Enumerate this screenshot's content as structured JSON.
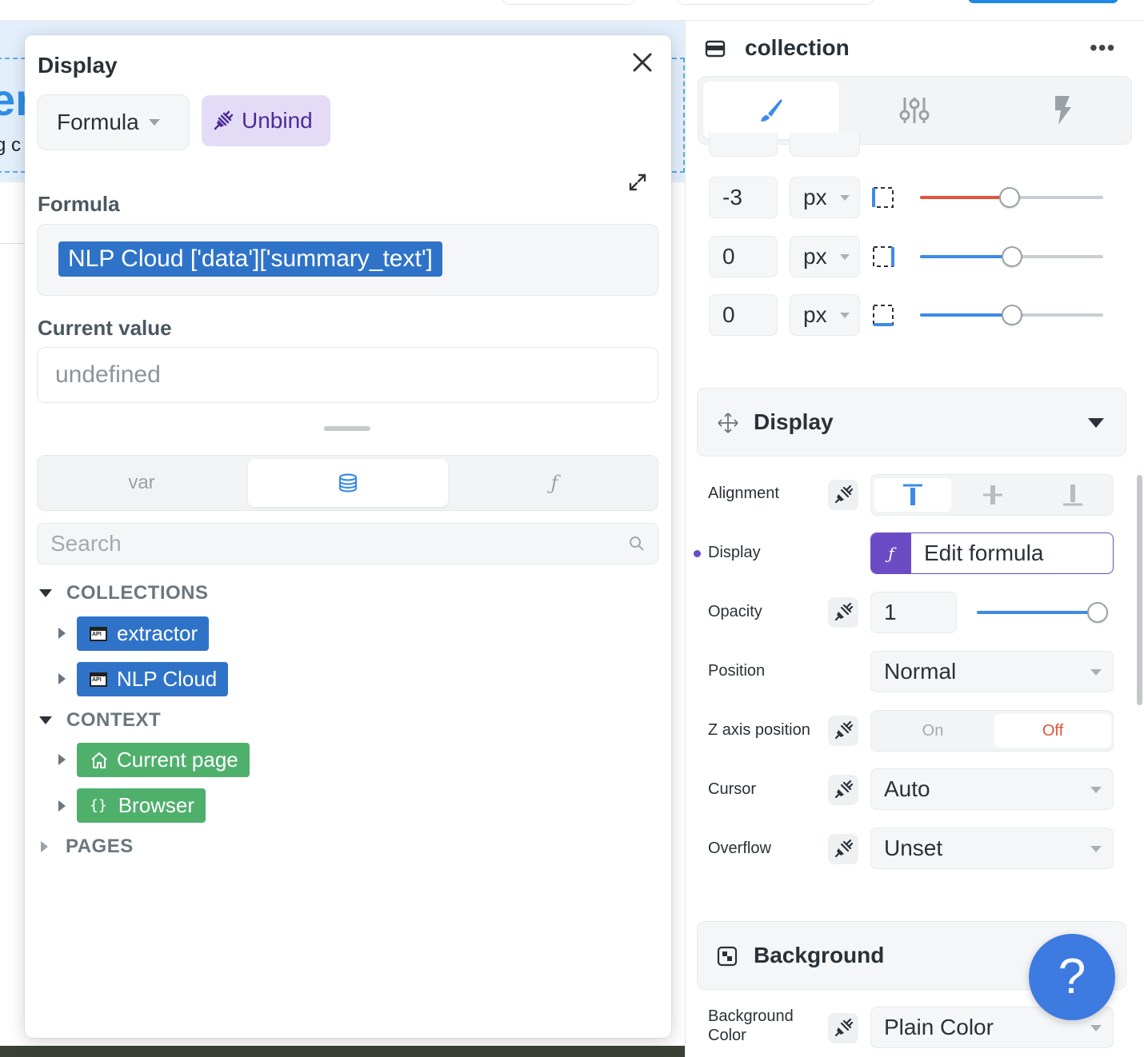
{
  "background": {
    "heading_fragment": "er",
    "text_fragment": "g c"
  },
  "modal": {
    "title": "Display",
    "source_dropdown": "Formula",
    "unbind_label": "Unbind",
    "formula_label": "Formula",
    "formula_value": "NLP Cloud ['data']['summary_text']",
    "current_value_label": "Current value",
    "current_value": "undefined",
    "tabs": {
      "var_label": "var",
      "db_icon": "database-icon",
      "fn_label": "ƒ"
    },
    "search_placeholder": "Search",
    "tree": {
      "collections_label": "COLLECTIONS",
      "collections": [
        {
          "label": "extractor",
          "icon": "api-icon"
        },
        {
          "label": "NLP Cloud",
          "icon": "api-icon"
        }
      ],
      "context_label": "CONTEXT",
      "context": [
        {
          "label": "Current page",
          "icon": "home-icon"
        },
        {
          "label": "Browser",
          "icon": "braces-icon"
        }
      ],
      "pages_label": "PAGES"
    }
  },
  "panel": {
    "title": "collection",
    "more": "•••",
    "spacing_rows": [
      {
        "value": "-3",
        "unit": "px",
        "slider": 0.5,
        "color": "#e0553a"
      },
      {
        "value": "0",
        "unit": "px",
        "slider": 0.5,
        "color": "#3d8be8"
      },
      {
        "value": "0",
        "unit": "px",
        "slider": 0.5,
        "color": "#3d8be8"
      }
    ],
    "display_section": {
      "title": "Display",
      "alignment_label": "Alignment",
      "display_label": "Display",
      "edit_formula": "Edit formula",
      "opacity_label": "Opacity",
      "opacity_value": "1",
      "position_label": "Position",
      "position_value": "Normal",
      "z_axis_label": "Z axis position",
      "z_on": "On",
      "z_off": "Off",
      "cursor_label": "Cursor",
      "cursor_value": "Auto",
      "overflow_label": "Overflow",
      "overflow_value": "Unset"
    },
    "background_section": {
      "title": "Background",
      "bg_color_label_1": "Background",
      "bg_color_label_2": "Color",
      "bg_color_value": "Plain Color"
    },
    "help": "?"
  },
  "colors": {
    "accent": "#3d7be0",
    "formula_chip": "#2f73c9",
    "context_chip": "#4fb06c",
    "unbind_bg": "#e4dcf6",
    "danger": "#e0553a"
  }
}
